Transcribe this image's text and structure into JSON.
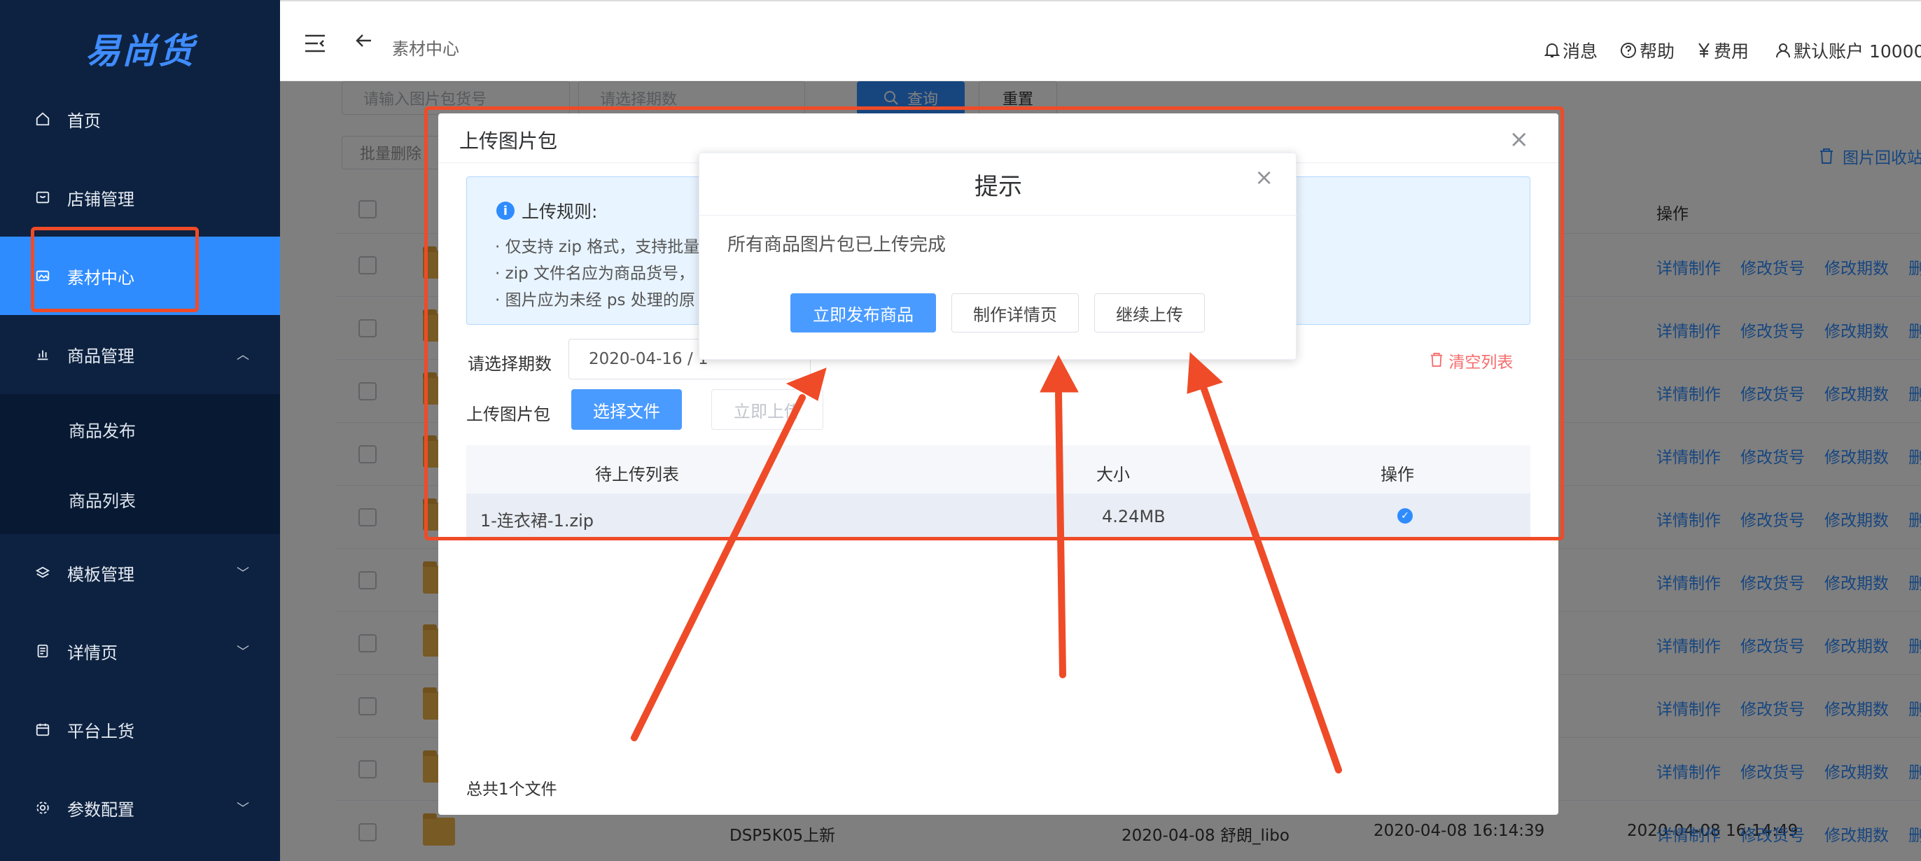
{
  "sidebar": {
    "logo": "易尚货",
    "items": [
      {
        "label": "首页",
        "icon": "home-icon"
      },
      {
        "label": "店铺管理",
        "icon": "shop-icon"
      },
      {
        "label": "素材中心",
        "icon": "image-icon"
      },
      {
        "label": "商品管理",
        "icon": "bar-chart-icon"
      },
      {
        "label": "模板管理",
        "icon": "layers-icon"
      },
      {
        "label": "详情页",
        "icon": "document-icon"
      },
      {
        "label": "平台上货",
        "icon": "calendar-icon"
      },
      {
        "label": "参数配置",
        "icon": "gear-icon"
      }
    ],
    "sub_items": [
      "商品发布",
      "商品列表"
    ],
    "chevron_up": "︿",
    "chevron_down": "﹀"
  },
  "header": {
    "breadcrumb": "素材中心",
    "links": {
      "messages": "消息",
      "help": "帮助",
      "fees": "费用",
      "account": "默认账户 10000"
    }
  },
  "filters": {
    "package_no_placeholder": "请输入图片包货号",
    "period_placeholder": "请选择期数",
    "query_button": "查询",
    "reset_button": "重置",
    "batch_delete_button": "批量删除",
    "recycle_bin_link": "图片回收站"
  },
  "table": {
    "ops_header": "操作",
    "ops": [
      "详情制作",
      "修改货号",
      "修改期数",
      "删"
    ],
    "last_row": {
      "name": "DSP5K05上新",
      "created": "2020-04-08 舒朗_libo",
      "time1": "2020-04-08 16:14:39",
      "time2": "2020-04-08 16:14:49"
    }
  },
  "upload_dialog": {
    "title": "上传图片包",
    "close": "×",
    "rules_title": "上传规则:",
    "rules": [
      "· 仅支持 zip 格式，支持批量",
      "· zip 文件名应为商品货号，",
      "· 图片应为未经 ps 处理的原"
    ],
    "period_label": "请选择期数",
    "period_value": "2020-04-16 / 1",
    "clear_list": "清空列表",
    "package_label": "上传图片包",
    "choose_file": "选择文件",
    "upload_now": "立即上传",
    "file_table": {
      "headers": [
        "待上传列表",
        "大小",
        "操作"
      ],
      "rows": [
        {
          "name": "1-连衣裙-1.zip",
          "size": "4.24MB"
        }
      ]
    },
    "total": "总共1个文件"
  },
  "tip_dialog": {
    "title": "提示",
    "close": "×",
    "message": "所有商品图片包已上传完成",
    "buttons": {
      "publish": "立即发布商品",
      "detail": "制作详情页",
      "continue": "继续上传"
    }
  },
  "colors": {
    "sidebar_bg": "#0d2240",
    "accent": "#2f8cff",
    "annotation": "#ef4b28",
    "danger": "#f56c6c"
  }
}
